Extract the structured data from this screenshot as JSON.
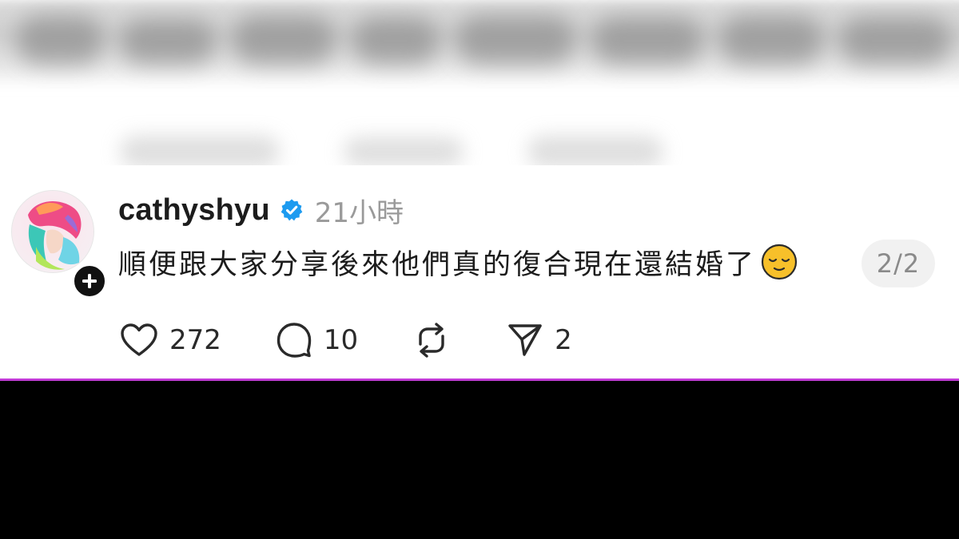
{
  "post": {
    "username": "cathyshyu",
    "timestamp": "21小時",
    "text": "順便跟大家分享後來他們真的復合現在還結婚了",
    "emoji": "relieved-face-emoji",
    "page_indicator": "2/2",
    "verified": true,
    "accent_color": "#1d9bf0"
  },
  "actions": {
    "likes": "272",
    "replies": "10",
    "shares": "2"
  },
  "icons": {
    "like": "heart-icon",
    "reply": "comment-icon",
    "repost": "repost-icon",
    "share": "send-icon",
    "follow": "plus-icon",
    "verified": "verified-badge-icon"
  },
  "colors": {
    "divider": "#c13bd6",
    "text": "#1c1c1c",
    "muted": "#9a9a9a"
  }
}
